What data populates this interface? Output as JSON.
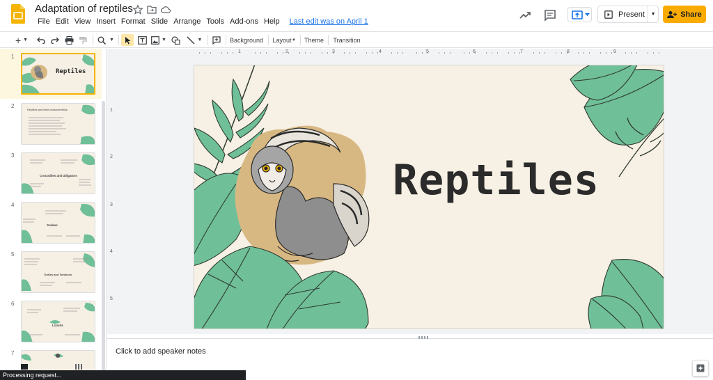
{
  "app": {
    "document_title": "Adaptation of reptiles",
    "last_edit": "Last edit was on April 1"
  },
  "menu": [
    "File",
    "Edit",
    "View",
    "Insert",
    "Format",
    "Slide",
    "Arrange",
    "Tools",
    "Add-ons",
    "Help"
  ],
  "header": {
    "present_label": "Present",
    "share_label": "Share"
  },
  "toolbar": {
    "background": "Background",
    "layout": "Layout",
    "theme": "Theme",
    "transition": "Transition"
  },
  "ruler": {
    "horizontal": [
      "1",
      "2",
      "3",
      "4",
      "5",
      "6",
      "7",
      "8",
      "9"
    ],
    "vertical": [
      "1",
      "2",
      "3",
      "4",
      "5"
    ]
  },
  "slides": [
    {
      "number": "1",
      "title": "Reptiles",
      "selected": true
    },
    {
      "number": "2",
      "title": "Reptiles and their characteristics",
      "selected": false
    },
    {
      "number": "3",
      "title": "Crocodiles and alligators",
      "selected": false
    },
    {
      "number": "4",
      "title": "Snakes",
      "selected": false
    },
    {
      "number": "5",
      "title": "Turtles and Tortoises",
      "selected": false
    },
    {
      "number": "6",
      "title": "Lizards",
      "selected": false
    },
    {
      "number": "7",
      "title": "",
      "selected": false
    }
  ],
  "main_slide": {
    "title": "Reptiles"
  },
  "notes": {
    "placeholder": "Click to add speaker notes"
  },
  "status": {
    "text": "Processing request..."
  },
  "colors": {
    "accent_yellow": "#f9ab00",
    "slide_bg": "#f7f0e4",
    "leaf_green": "#6fbf99",
    "blob_tan": "#d8b882",
    "link_blue": "#1a73e8"
  },
  "icons": {
    "app": "slides-logo-icon",
    "star": "star-icon",
    "move": "folder-move-icon",
    "cloud": "cloud-saved-icon",
    "activity": "trending-icon",
    "comments": "comment-icon",
    "present": "present-icon",
    "share": "lock-person-icon"
  }
}
